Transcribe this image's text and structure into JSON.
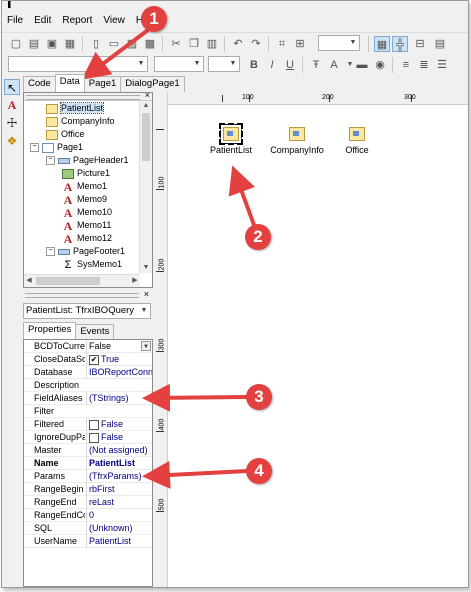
{
  "menubar": [
    "File",
    "Edit",
    "Report",
    "View",
    "He"
  ],
  "designer_tabs": [
    {
      "label": "Code",
      "selected": false
    },
    {
      "label": "Data",
      "selected": true
    },
    {
      "label": "Page1",
      "selected": false
    },
    {
      "label": "DialogPage1",
      "selected": false
    }
  ],
  "tree": [
    {
      "label": "PatientList",
      "icon": "query-icon",
      "level": 2,
      "selected": true
    },
    {
      "label": "CompanyInfo",
      "icon": "query-icon",
      "level": 2,
      "selected": false
    },
    {
      "label": "Office",
      "icon": "query-icon",
      "level": 2,
      "selected": false
    },
    {
      "label": "Page1",
      "icon": "page-icon",
      "level": 1,
      "selected": false
    },
    {
      "label": "PageHeader1",
      "icon": "band-icon",
      "level": 2,
      "selected": false
    },
    {
      "label": "Picture1",
      "icon": "picture-icon",
      "level": 3,
      "selected": false
    },
    {
      "label": "Memo1",
      "icon": "memo-icon",
      "level": 3,
      "selected": false
    },
    {
      "label": "Memo9",
      "icon": "memo-icon",
      "level": 3,
      "selected": false
    },
    {
      "label": "Memo10",
      "icon": "memo-icon",
      "level": 3,
      "selected": false
    },
    {
      "label": "Memo11",
      "icon": "memo-icon",
      "level": 3,
      "selected": false
    },
    {
      "label": "Memo12",
      "icon": "memo-icon",
      "level": 3,
      "selected": false
    },
    {
      "label": "PageFooter1",
      "icon": "band-icon",
      "level": 2,
      "selected": false
    },
    {
      "label": "SysMemo1",
      "icon": "sysmemo-icon",
      "level": 3,
      "selected": false
    }
  ],
  "object_selector": "PatientList: TfrxIBOQuery",
  "inspector_tabs": [
    {
      "label": "Properties",
      "selected": true
    },
    {
      "label": "Events",
      "selected": false
    }
  ],
  "properties": [
    {
      "name": "BCDToCurrer",
      "value": "False",
      "checkbox": false,
      "bold": false,
      "dropdown": true
    },
    {
      "name": "CloseDataSou",
      "value": "True",
      "checkbox": true,
      "checked": true,
      "bold": false
    },
    {
      "name": "Database",
      "value": "IBOReportConn",
      "checkbox": false,
      "bold": false
    },
    {
      "name": "Description",
      "value": "",
      "checkbox": false,
      "bold": false
    },
    {
      "name": "FieldAliases",
      "value": "(TStrings)",
      "checkbox": false,
      "bold": false
    },
    {
      "name": "Filter",
      "value": "",
      "checkbox": false,
      "bold": false
    },
    {
      "name": "Filtered",
      "value": "False",
      "checkbox": true,
      "checked": false,
      "bold": false
    },
    {
      "name": "IgnoreDupPa",
      "value": "False",
      "checkbox": true,
      "checked": false,
      "bold": false
    },
    {
      "name": "Master",
      "value": "(Not assigned)",
      "checkbox": false,
      "bold": false
    },
    {
      "name": "Name",
      "value": "PatientList",
      "checkbox": false,
      "bold": true
    },
    {
      "name": "Params",
      "value": "(TfrxParams)",
      "checkbox": false,
      "bold": false
    },
    {
      "name": "RangeBegin",
      "value": "rbFirst",
      "checkbox": false,
      "bold": false
    },
    {
      "name": "RangeEnd",
      "value": "reLast",
      "checkbox": false,
      "bold": false
    },
    {
      "name": "RangeEndCo",
      "value": "0",
      "checkbox": false,
      "bold": false
    },
    {
      "name": "SQL",
      "value": "(Unknown)",
      "checkbox": false,
      "bold": false
    },
    {
      "name": "UserName",
      "value": "PatientList",
      "checkbox": false,
      "bold": false
    }
  ],
  "ruler_h": [
    "100",
    "200",
    "300"
  ],
  "ruler_v": [
    "100",
    "200",
    "300",
    "400",
    "500"
  ],
  "components": [
    {
      "label": "PatientList",
      "selected": true
    },
    {
      "label": "CompanyInfo",
      "selected": false
    },
    {
      "label": "Office",
      "selected": false
    }
  ],
  "callouts": [
    "1",
    "2",
    "3",
    "4"
  ],
  "colors": {
    "callout": "#e34040",
    "value_text": "#000080"
  }
}
